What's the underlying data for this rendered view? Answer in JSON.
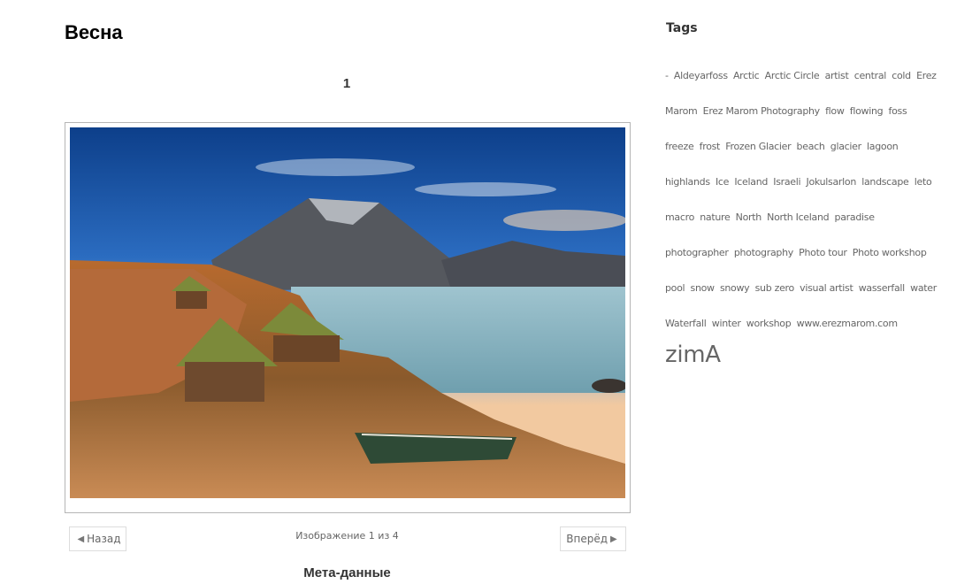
{
  "page": {
    "title": "Весна",
    "image_number": "1"
  },
  "gallery": {
    "image_alt": "Iceland landscape with turf houses, mountain, lagoon and boat",
    "prev_label": "Назад",
    "next_label": "Вперёд",
    "counter": "Изображение 1 из 4",
    "meta_title": "Мета-данные",
    "icons": {
      "prev": "◀",
      "next": "▶"
    }
  },
  "sidebar": {
    "tags_title": "Tags",
    "tags": [
      "-",
      "Aldeyarfoss",
      "Arctic",
      "Arctic Circle",
      "artist",
      "central",
      "cold",
      "Erez Marom",
      "Erez Marom Photography",
      "flow",
      "flowing",
      "foss",
      "freeze",
      "frost",
      "Frozen Glacier",
      "beach",
      "glacier",
      "lagoon",
      "highlands",
      "Ice",
      "Iceland",
      "Israeli",
      "Jokulsarlon",
      "landscape",
      "leto",
      "macro",
      "nature",
      "North",
      "North Iceland",
      "paradise",
      "photographer",
      "photography",
      "Photo tour",
      "Photo workshop",
      "pool",
      "snow",
      "snowy",
      "sub zero",
      "visual artist",
      "wasserfall",
      "water",
      "Waterfall",
      "winter",
      "workshop",
      "www.erezmarom.com",
      "zimA"
    ],
    "large_tag": "zimA"
  }
}
